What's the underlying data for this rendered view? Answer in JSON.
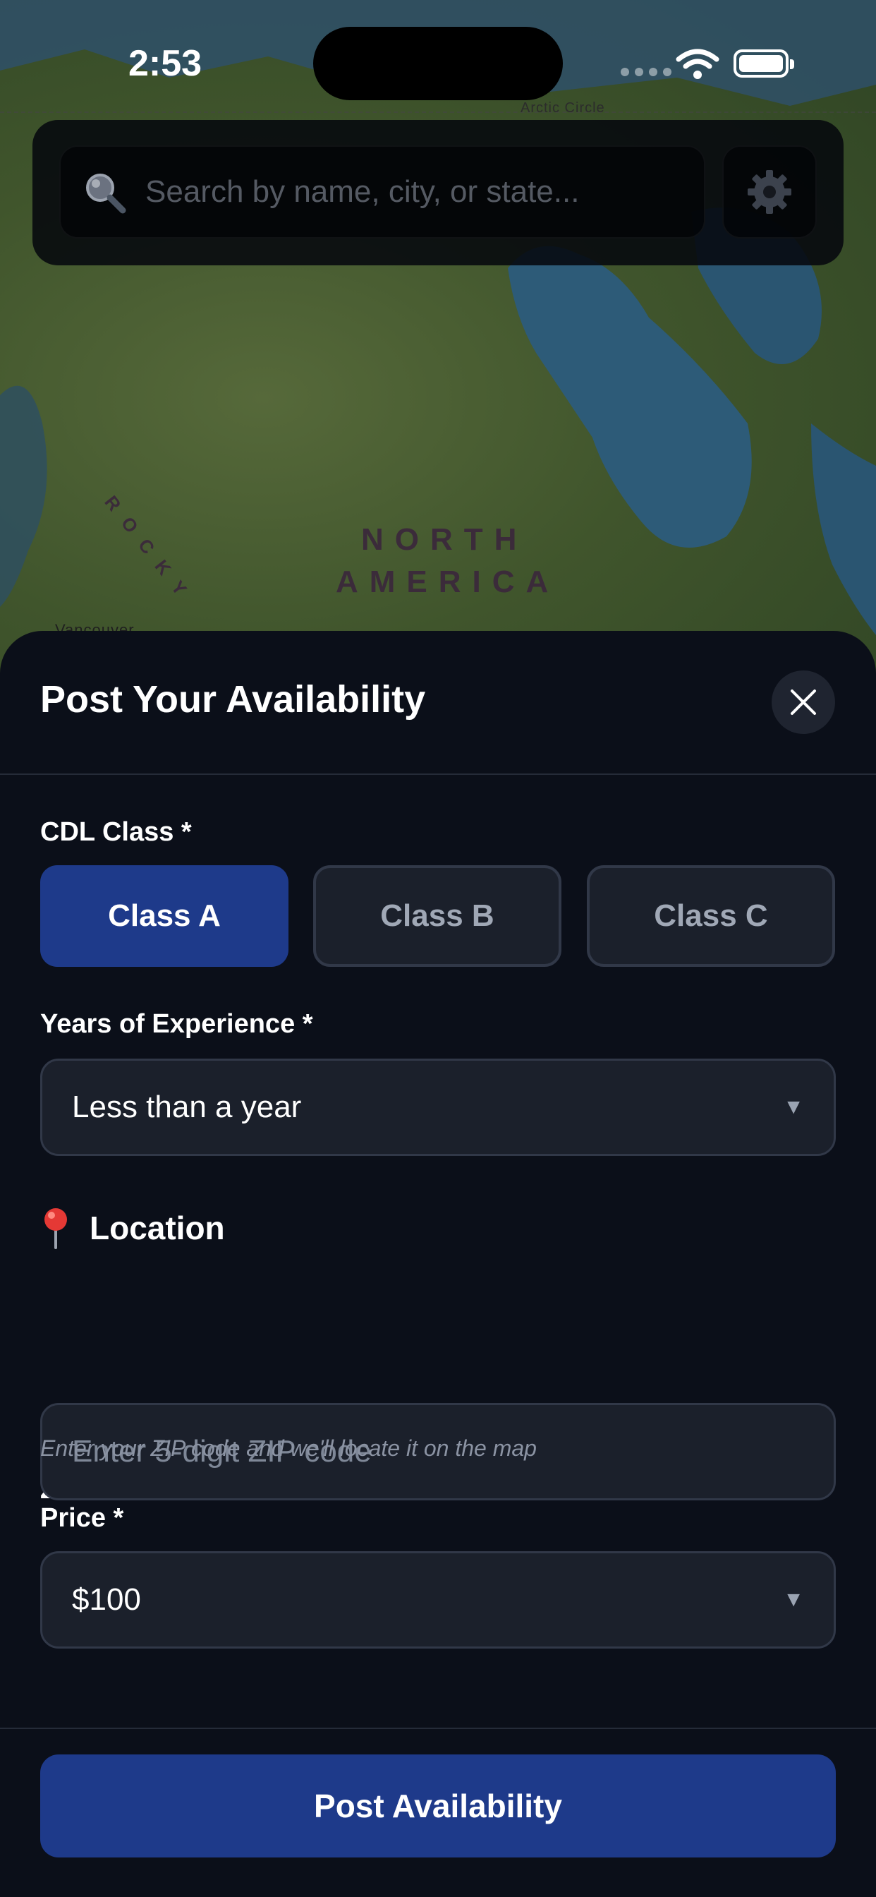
{
  "status_bar": {
    "time": "2:53"
  },
  "map": {
    "continent_line1": "NORTH",
    "continent_line2": "AMERICA",
    "arctic_label": "Arctic Circle",
    "mountains_label": "R O C K Y",
    "city_label": "Vancouver"
  },
  "search": {
    "placeholder": "Search by name, city, or state...",
    "icon": "search-icon",
    "settings_icon": "gear-icon"
  },
  "sheet": {
    "title": "Post Your Availability",
    "close_icon": "close-icon",
    "cdl": {
      "label": "CDL Class *",
      "options": [
        "Class A",
        "Class B",
        "Class C"
      ],
      "selected": "Class A"
    },
    "experience": {
      "label": "Years of Experience *",
      "value": "Less than a year"
    },
    "location": {
      "icon": "pin-icon",
      "title": "Location",
      "zip_label": "ZIP Code *",
      "zip_placeholder": "Enter 5-digit ZIP code",
      "zip_helper": "Enter your ZIP code and we'll locate it on the map"
    },
    "price": {
      "label": "Price *",
      "value": "$100"
    },
    "submit_label": "Post Availability"
  },
  "colors": {
    "sheet_bg": "#0b0f19",
    "accent": "#1e3a8a",
    "field_bg": "#1b202b",
    "field_border": "#313848"
  }
}
